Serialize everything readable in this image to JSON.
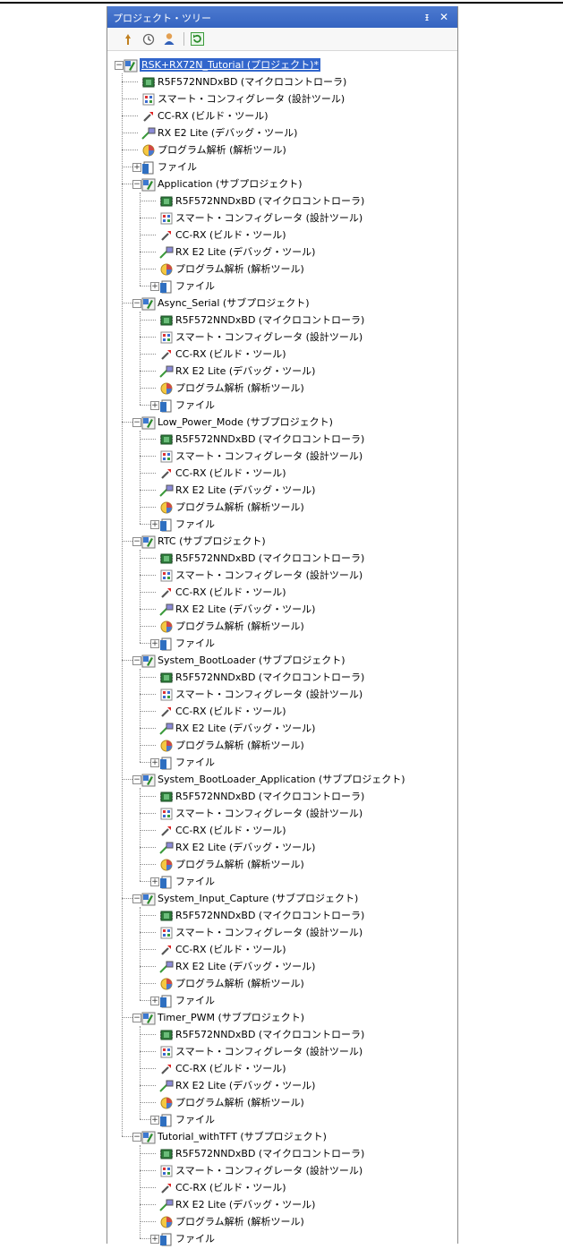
{
  "panel": {
    "title": "プロジェクト・ツリー",
    "pin_glyph": "ᵻ",
    "close_glyph": "✕"
  },
  "toolbar": {
    "icons": [
      "sort-icon",
      "clock-icon",
      "user-icon",
      "refresh-icon"
    ]
  },
  "colors": {
    "title_bar": "#3d6cc8",
    "selection": "#3266cc",
    "cpu_green": "#2f7d3c",
    "wrench": "#d22",
    "file_blue": "#2f6fc0"
  },
  "tree": {
    "root_label": "RSK+RX72N_Tutorial (プロジェクト)*",
    "root_children": [
      "R5F572NNDxBD (マイクロコントローラ)",
      "スマート・コンフィグレータ (設計ツール)",
      "CC-RX (ビルド・ツール)",
      "RX E2 Lite (デバッグ・ツール)",
      "プログラム解析 (解析ツール)",
      "ファイル"
    ],
    "sub_children": [
      "R5F572NNDxBD (マイクロコントローラ)",
      "スマート・コンフィグレータ (設計ツール)",
      "CC-RX (ビルド・ツール)",
      "RX E2 Lite (デバッグ・ツール)",
      "プログラム解析 (解析ツール)",
      "ファイル"
    ],
    "subprojects": [
      "Application (サブプロジェクト)",
      "Async_Serial (サブプロジェクト)",
      "Low_Power_Mode (サブプロジェクト)",
      "RTC (サブプロジェクト)",
      "System_BootLoader (サブプロジェクト)",
      "System_BootLoader_Application (サブプロジェクト)",
      "System_Input_Capture (サブプロジェクト)",
      "Timer_PWM (サブプロジェクト)",
      "Tutorial_withTFT (サブプロジェクト)"
    ]
  }
}
